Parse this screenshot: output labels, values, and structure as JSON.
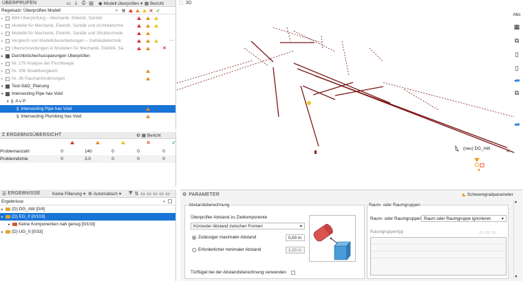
{
  "check_panel": {
    "title": "ÜBERPRÜFEN",
    "check_model_label": "Modell überprüfen",
    "report_label": "Bericht",
    "ruleset_label": "Regelsatz: Überprüftes Modell",
    "rows": [
      {
        "text": "BIM-Überprüfung – Mechanik, Elektrik, Sanitär",
        "style": "gray",
        "indent": 0
      },
      {
        "text": "Modelle für Mechanik, Elektrik, Sanitär und Architekturmo",
        "style": "gray",
        "indent": 0
      },
      {
        "text": "Modelle für Mechanik, Elektrik, Sanitär und Strukturmode",
        "style": "gray",
        "indent": 0
      },
      {
        "text": "Vergleich von Modellüberarbeitungen – Gebäudetechnik",
        "style": "gray",
        "indent": 0
      },
      {
        "text": "Überschneidungen in Modellen für Mechanik, Elektrik, Sani",
        "style": "gray",
        "indent": 0
      },
      {
        "text": "Durchbrüche/Aussparungen Überprüfen",
        "style": "normal",
        "indent": 0
      },
      {
        "text": "Nr. 179 Analyse der Fluchtwege",
        "style": "gray",
        "indent": 0
      },
      {
        "text": "Nr. 206 Modellvergleich",
        "style": "gray",
        "indent": 0
      },
      {
        "text": "Nr. 36 Raumanforderungen",
        "style": "gray",
        "indent": 0
      },
      {
        "text": "Test-S&D_Planung",
        "style": "normal",
        "indent": 0
      },
      {
        "text": "Intersecting Pipe has Void",
        "style": "normal",
        "indent": 0
      },
      {
        "text": "A v P",
        "style": "normal",
        "indent": 1
      },
      {
        "text": "Intersecting Pipe has Void",
        "style": "sel",
        "indent": 2
      },
      {
        "text": "Intersecting Plumbing has Void",
        "style": "normal",
        "indent": 2
      }
    ]
  },
  "summary_panel": {
    "title": "ERGEBNISÜBERSICHT",
    "report_label": "Bericht",
    "rows": [
      {
        "label": "Problemanzahl",
        "values": [
          "0",
          "140",
          "0",
          "0",
          "0"
        ]
      },
      {
        "label": "Problemdichte",
        "values": [
          "0",
          "3.0",
          "0",
          "0",
          "0"
        ]
      }
    ]
  },
  "results_panel": {
    "title": "ERGEBNISSE",
    "filter_label": "Keine Filterung",
    "auto_label": "Automatisch",
    "col_label": "Ergebnisse",
    "items": [
      {
        "text": "(D) DG_AW [0/4]",
        "sel": false,
        "indent": 0
      },
      {
        "text": "(D) EG_0 [0/103]",
        "sel": true,
        "indent": 0
      },
      {
        "text": "Keine Komponenten nah genug [0/103]",
        "sel": false,
        "indent": 1
      },
      {
        "text": "(D) UG_0 [0/33]",
        "sel": false,
        "indent": 0
      }
    ]
  },
  "view3d": {
    "title": "3D",
    "object_label": "(neu) DG_AW"
  },
  "params_panel": {
    "title": "PARAMETER",
    "gravity_label": "Schweregradparameter",
    "distance_group": "Abstandsberechnung",
    "checked_distance_label": "Überprüfter Abstand zu Zielkomponente",
    "distance_select": "Kürzester Abstand zwischen Formen",
    "radio_max_label": "Zulässiger maximaler Abstand",
    "radio_max_value": "0,00 m",
    "radio_min_label": "Erforderlicher minimaler Abstand",
    "radio_min_value": "1,00 m",
    "door_label": "Türflügel bei der Abstandsberechnung verwenden",
    "room_group": "Raum- oder Raumgruppen",
    "room_label": "Raum- oder Raumgruppen",
    "room_select": "Raum oder Raumgruppe ignorieren",
    "room_type_label": "Raumgruppentyp"
  },
  "colors": {
    "selection": "#1874d6",
    "pipe": "#7a1414",
    "accent": "#e88a1a"
  }
}
